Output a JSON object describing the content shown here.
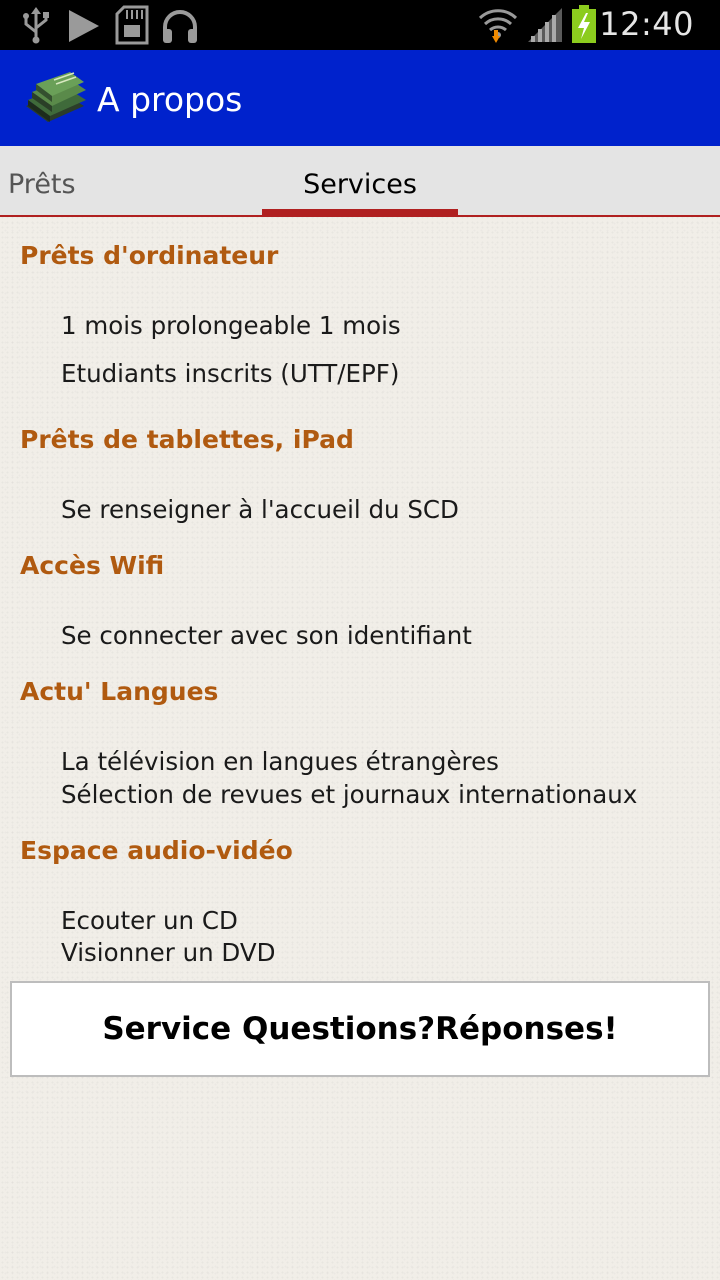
{
  "status_bar": {
    "time": "12:40",
    "icons": [
      "usb-icon",
      "play-icon",
      "sd-card-icon",
      "headphones-icon",
      "wifi-icon",
      "signal-icon",
      "battery-charging-icon"
    ],
    "battery_color": "#8ccc1e"
  },
  "action_bar": {
    "title": "A propos",
    "icon": "books-icon",
    "background": "#0022cc"
  },
  "tabs": [
    {
      "label": "Prêts",
      "selected": false
    },
    {
      "label": "Services",
      "selected": true
    }
  ],
  "accent_color": "#b02020",
  "section_title_color": "#b05a10",
  "sections": [
    {
      "title": "Prêts d'ordinateur",
      "lines": [
        "1 mois prolongeable 1 mois",
        "Etudiants inscrits (UTT/EPF)"
      ]
    },
    {
      "title": "Prêts de tablettes, iPad",
      "lines": [
        "Se renseigner à l'accueil du SCD"
      ]
    },
    {
      "title": "Accès Wifi",
      "lines": [
        "Se connecter avec son identifiant"
      ]
    },
    {
      "title": "Actu' Langues",
      "lines": [
        "La télévision en langues étrangères",
        "Sélection de revues et journaux internationaux"
      ]
    },
    {
      "title": "Espace audio-vidéo",
      "lines": [
        "Ecouter un CD",
        "Visionner un DVD"
      ]
    }
  ],
  "button": {
    "label": "Service Questions?Réponses!"
  }
}
